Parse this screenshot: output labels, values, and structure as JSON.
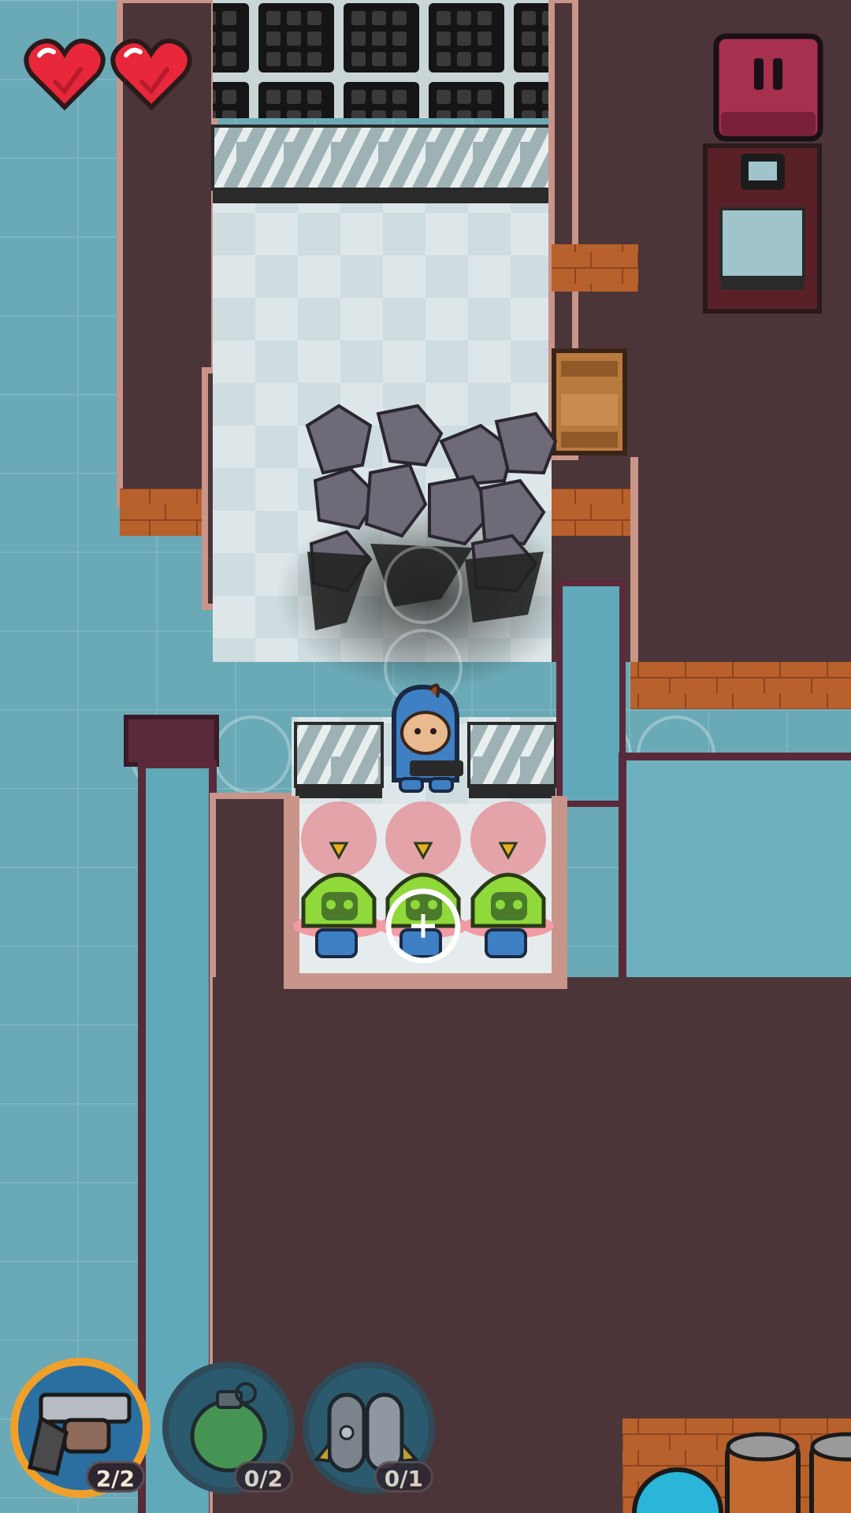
{
  "hud": {
    "health": {
      "current": 2,
      "max": 2
    },
    "pause_icon": "pause-icon"
  },
  "weapons": [
    {
      "name": "revolver",
      "icon": "revolver-icon",
      "count": "2/2",
      "selected": true
    },
    {
      "name": "grenade",
      "icon": "grenade-icon",
      "count": "0/2",
      "selected": false
    },
    {
      "name": "rocket",
      "icon": "rocket-icon",
      "count": "0/1",
      "selected": false
    }
  ],
  "colors": {
    "water": "#6aa9b6",
    "wall": "#4b3538",
    "floor": "#dfe8ea",
    "heart": "#e8283a",
    "pause": "#a6304e",
    "enemy": "#8fd93a",
    "player": "#3f7fc4",
    "accent_ring": "#f0a02a"
  }
}
